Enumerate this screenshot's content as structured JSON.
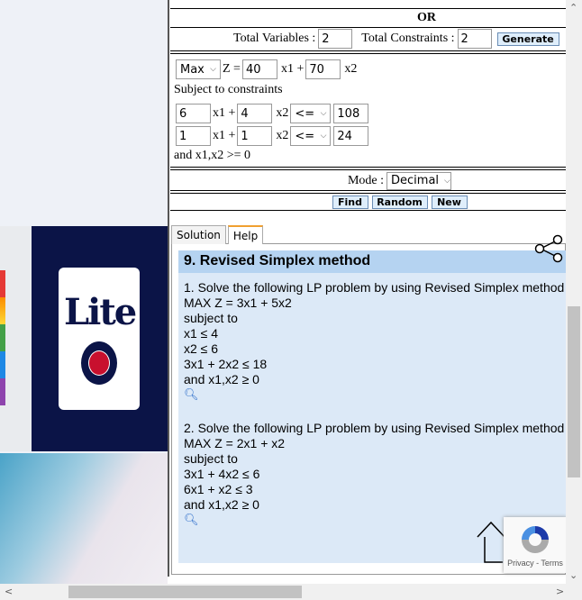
{
  "form": {
    "or_label": "OR",
    "total_variables_label": "Total Variables :",
    "total_variables": "2",
    "total_constraints_label": "Total Constraints :",
    "total_constraints": "2",
    "generate": "Generate",
    "objective": {
      "type": "Max",
      "z_label": "Z =",
      "c1": "40",
      "x1": "x1 +",
      "c2": "70",
      "x2": "x2"
    },
    "subject_label": "Subject to constraints",
    "constraints": [
      {
        "a1": "6",
        "a2": "4",
        "op": "<=",
        "rhs": "108"
      },
      {
        "a1": "1",
        "a2": "1",
        "op": "<=",
        "rhs": "24"
      }
    ],
    "x1_label": "x1 +",
    "x2_label": "x2",
    "nonneg": "and x1,x2 >= 0",
    "mode_label": "Mode :",
    "mode": "Decimal",
    "find": "Find",
    "random": "Random",
    "new": "New"
  },
  "tabs": [
    {
      "label": "Solution"
    },
    {
      "label": "Help",
      "active": true
    }
  ],
  "help": {
    "title": "9. Revised Simplex method",
    "p1": [
      "1. Solve the following LP problem by using Revised Simplex method",
      "MAX Z = 3x1 + 5x2",
      "subject to",
      "x1 ≤ 4",
      "x2 ≤ 6",
      "3x1 + 2x2 ≤ 18",
      "and x1,x2 ≥ 0"
    ],
    "p2": [
      "2. Solve the following LP problem by using Revised Simplex method",
      "MAX Z = 2x1 + x2",
      "subject to",
      "3x1 + 4x2 ≤ 6",
      "6x1 + x2 ≤ 3",
      "and x1,x2 ≥ 0"
    ]
  },
  "ad": {
    "brand": "Lite"
  },
  "recaptcha": {
    "text": "Privacy - Terms"
  },
  "colors": {
    "button_bg": "#dfeefb",
    "help_bg": "#dce9f7",
    "help_title_bg": "#b5d3f1",
    "ad_bg": "#0b1447"
  }
}
